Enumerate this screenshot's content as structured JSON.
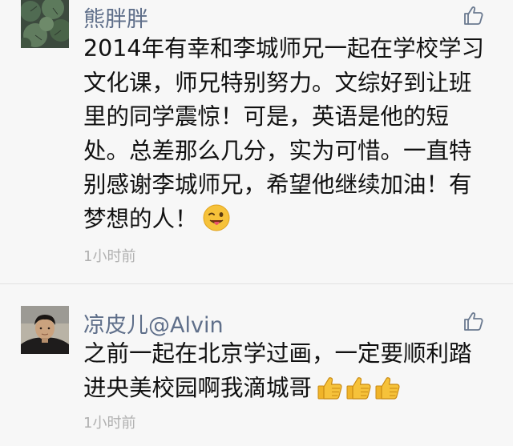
{
  "comments": [
    {
      "author": "熊胖胖",
      "lines": [
        "2014年有幸和李城师兄一起在学校学习",
        "文化课，师兄特别努力。文综好到让班",
        "里的同学震惊！可是，英语是他的短",
        "处。总差那么几分，实为可惜。一直特",
        "别感谢李城师兄，希望他继续加油！有",
        "梦想的人！"
      ],
      "emoji": "wink-tongue-emoji",
      "time": "1小时前"
    },
    {
      "author": "凉皮儿@Alvin",
      "lines": [
        "之前一起在北京学过画，一定要顺利踏",
        "进央美校园啊我滴城哥"
      ],
      "emoji": "thumbs-up-emoji",
      "time": "1小时前"
    }
  ],
  "colors": {
    "background": "#f7f7f7",
    "author": "#5f6f8a",
    "text": "#111111",
    "time": "#b0b0b0",
    "like_icon": "#6b7a90"
  }
}
